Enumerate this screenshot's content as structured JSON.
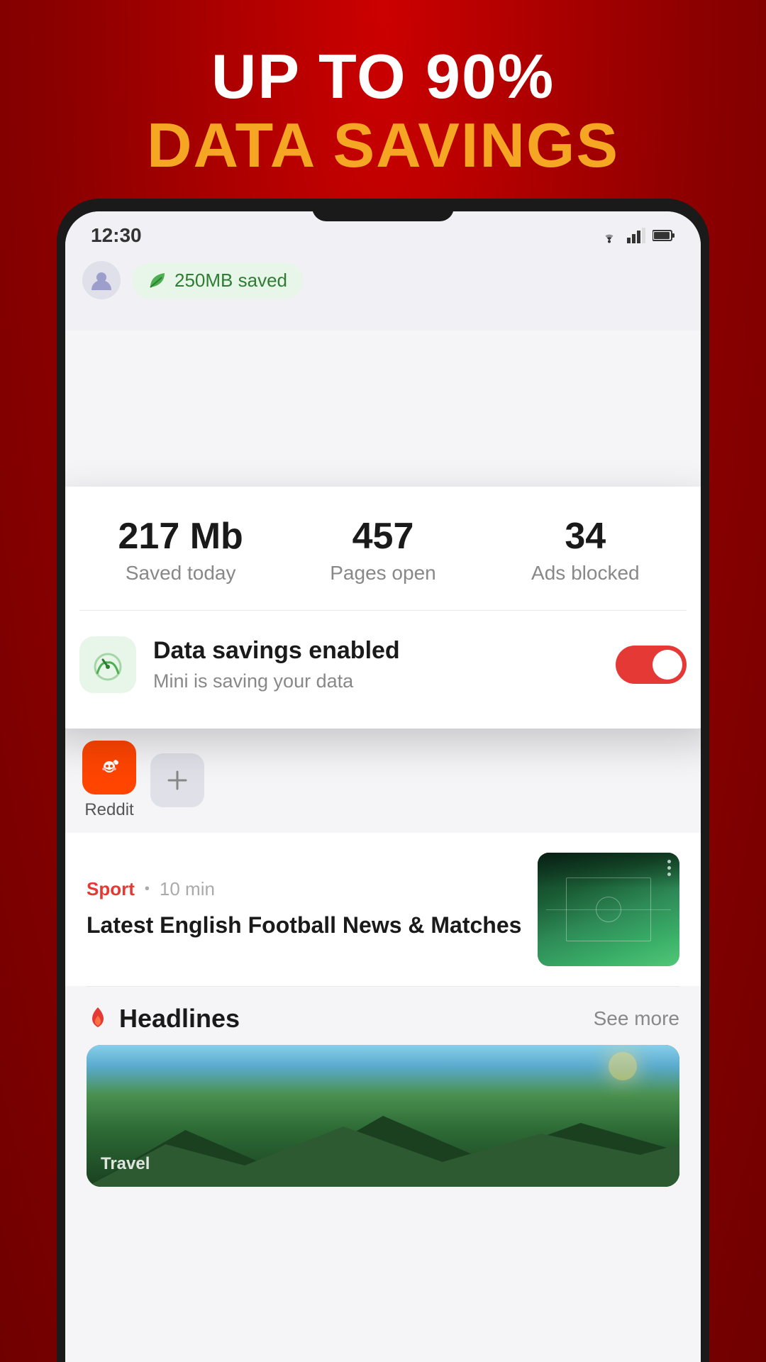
{
  "header": {
    "line1": "UP TO 90%",
    "line2": "DATA SAVINGS"
  },
  "status_bar": {
    "time": "12:30"
  },
  "browser_bar": {
    "data_saved_badge": "250MB saved"
  },
  "stats_card": {
    "stat1_value": "217 Mb",
    "stat1_label": "Saved today",
    "stat2_value": "457",
    "stat2_label": "Pages open",
    "stat3_value": "34",
    "stat3_label": "Ads blocked",
    "data_savings_title": "Data savings enabled",
    "data_savings_subtitle": "Mini is saving your data"
  },
  "news_article": {
    "category": "Sport",
    "time": "10 min",
    "title": "Latest English Football News & Matches"
  },
  "headlines": {
    "title": "Headlines",
    "see_more": "See more",
    "image_label": "Travel"
  },
  "tabs": {
    "reddit_label": "Reddit",
    "add_label": "+"
  }
}
